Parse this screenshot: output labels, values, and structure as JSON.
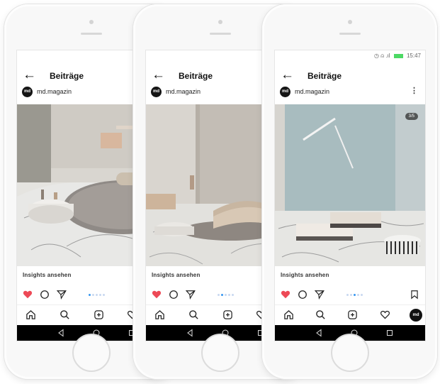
{
  "header": {
    "title": "Beiträge",
    "back": "←"
  },
  "account": {
    "name": "md.magazin",
    "avatar_text": "md",
    "more": "⋮"
  },
  "status": {
    "time": "15:47",
    "icons": "◷ ⍝ .ıl"
  },
  "post": {
    "caption": "Insights ansehen",
    "counter": "3/5"
  },
  "colors": {
    "like": "#ed4956",
    "active_dot": "#3897f0",
    "battery": "#4cd964"
  },
  "icons": {
    "like": "heart-icon",
    "comment": "comment-icon",
    "share": "send-icon",
    "save": "bookmark-icon",
    "home": "home-icon",
    "search": "search-icon",
    "add": "add-icon",
    "activity": "heart-outline-icon",
    "profile": "md-avatar-icon",
    "sys_back": "triangle-back-icon",
    "sys_home": "circle-home-icon",
    "sys_recent": "square-recent-icon"
  },
  "phones": [
    {
      "dots_active": 0
    },
    {
      "dots_active": 1
    },
    {
      "dots_active": 2
    }
  ]
}
